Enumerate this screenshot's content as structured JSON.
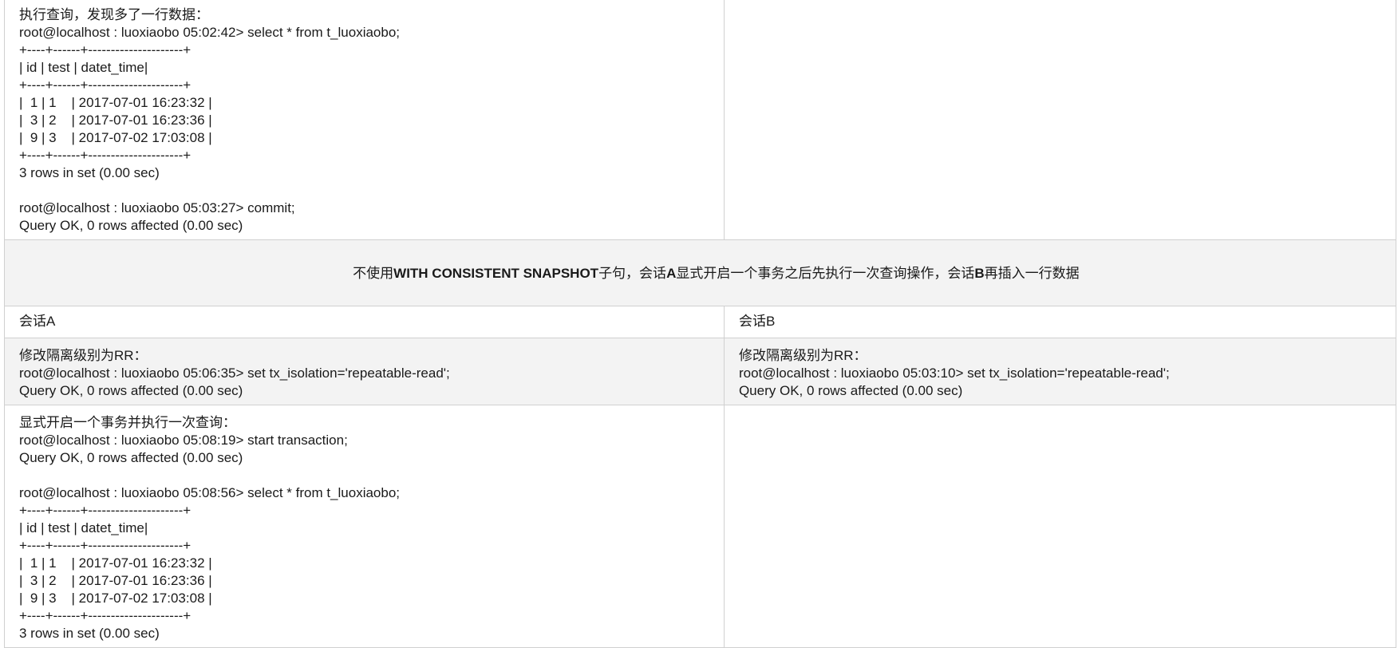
{
  "section_title": "不使用WITH CONSISTENT SNAPSHOT子句，会话A显式开启一个事务之后先执行一次查询操作，会话B再插入一行数据",
  "headers": {
    "session_a": "会话A",
    "session_b": "会话B"
  },
  "top_block": {
    "session_a_lines": [
      "执行查询，发现多了一行数据：",
      "root@localhost : luoxiaobo 05:02:42> select * from t_luoxiaobo;",
      "+----+------+---------------------+",
      "| id | test | datet_time|",
      "+----+------+---------------------+",
      "|  1 | 1    | 2017-07-01 16:23:32 |",
      "|  3 | 2    | 2017-07-01 16:23:36 |",
      "|  9 | 3    | 2017-07-02 17:03:08 |",
      "+----+------+---------------------+",
      "3 rows in set (0.00 sec)",
      "",
      "root@localhost : luoxiaobo 05:03:27> commit;",
      "Query OK, 0 rows affected (0.00 sec)"
    ],
    "session_b_lines": []
  },
  "isolation_row": {
    "session_a_lines": [
      "修改隔离级别为RR：",
      "root@localhost : luoxiaobo 05:06:35> set tx_isolation='repeatable-read';",
      "Query OK, 0 rows affected (0.00 sec)"
    ],
    "session_b_lines": [
      "修改隔离级别为RR：",
      "root@localhost : luoxiaobo 05:03:10> set tx_isolation='repeatable-read';",
      "Query OK, 0 rows affected (0.00 sec)"
    ]
  },
  "transaction_row": {
    "session_a_lines": [
      "显式开启一个事务并执行一次查询：",
      "root@localhost : luoxiaobo 05:08:19> start transaction;",
      "Query OK, 0 rows affected (0.00 sec)",
      "",
      "root@localhost : luoxiaobo 05:08:56> select * from t_luoxiaobo;",
      "+----+------+---------------------+",
      "| id | test | datet_time|",
      "+----+------+---------------------+",
      "|  1 | 1    | 2017-07-01 16:23:32 |",
      "|  3 | 2    | 2017-07-01 16:23:36 |",
      "|  9 | 3    | 2017-07-02 17:03:08 |",
      "+----+------+---------------------+",
      "3 rows in set (0.00 sec)"
    ],
    "session_b_lines": []
  }
}
